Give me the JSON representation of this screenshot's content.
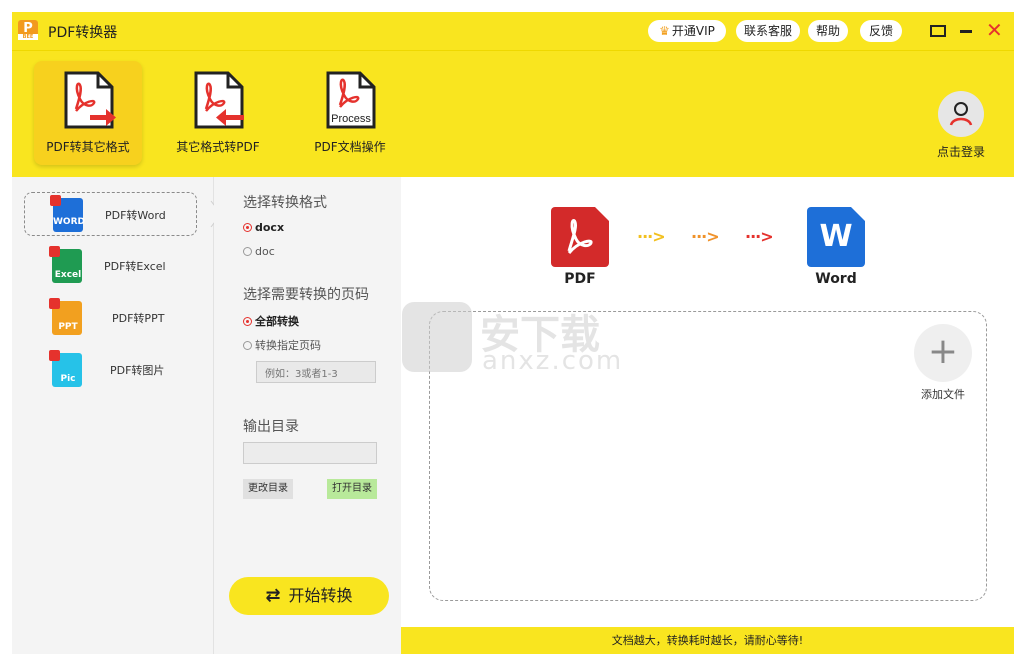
{
  "title_bar": {
    "logo_letter": "P",
    "logo_sub": "BEE",
    "app_title": "PDF转换器",
    "vip_label": "开通VIP",
    "service_label": "联系客服",
    "help_label": "帮助",
    "feedback_label": "反馈",
    "close_glyph": "✕"
  },
  "toolbar": {
    "tools": [
      {
        "label": "PDF转其它格式",
        "icon": "pdf-to-other-icon",
        "active": true
      },
      {
        "label": "其它格式转PDF",
        "icon": "other-to-pdf-icon",
        "active": false
      },
      {
        "label": "PDF文档操作",
        "icon": "pdf-process-icon",
        "icon_text": "Process",
        "active": false
      }
    ],
    "login_label": "点击登录"
  },
  "sidebar": {
    "items": [
      {
        "label": "PDF转Word",
        "icon_text": "WORD",
        "color": "#1e6fd8",
        "active": true
      },
      {
        "label": "PDF转Excel",
        "icon_text": "Excel",
        "color": "#1f9b52",
        "active": false
      },
      {
        "label": "PDF转PPT",
        "icon_text": "PPT",
        "color": "#f2a01f",
        "active": false
      },
      {
        "label": "PDF转图片",
        "icon_text": "Pic",
        "color": "#26c2e8",
        "active": false
      }
    ]
  },
  "options": {
    "format_title": "选择转换格式",
    "formats": [
      {
        "label": "docx",
        "selected": true
      },
      {
        "label": "doc",
        "selected": false
      }
    ],
    "pages_title": "选择需要转换的页码",
    "pages": [
      {
        "label": "全部转换",
        "selected": true
      },
      {
        "label": "转换指定页码",
        "selected": false
      }
    ],
    "page_placeholder": "例如：3或者1-3",
    "output_title": "输出目录",
    "output_value": "",
    "change_dir_label": "更改目录",
    "open_dir_label": "打开目录",
    "start_label": "开始转换"
  },
  "main": {
    "from_label": "PDF",
    "to_label": "Word",
    "to_icon_letter": "W",
    "flow_arrows": "···>",
    "add_glyph": "+",
    "add_label": "添加文件"
  },
  "watermark": {
    "text": "安下载",
    "sub": "anxz.com"
  },
  "status": {
    "message": "文档越大，转换耗时越长，请耐心等待!"
  },
  "colors": {
    "brand_yellow": "#f9e51f",
    "pdf_red": "#d32a2a",
    "word_blue": "#1e6fd8"
  }
}
